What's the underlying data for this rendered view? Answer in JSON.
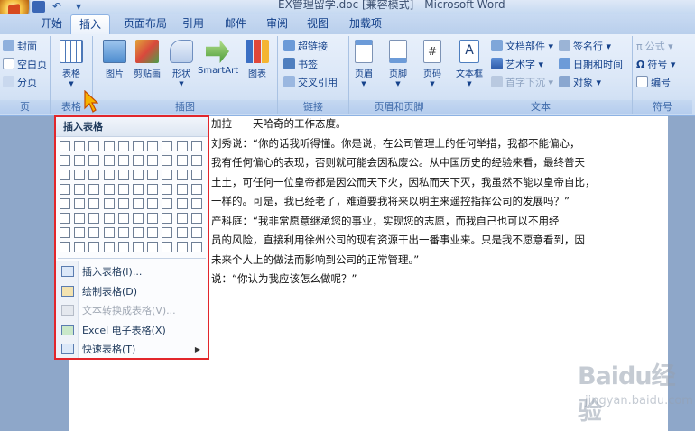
{
  "window": {
    "title": "EX管理留学.doc [兼容模式] - Microsoft Word"
  },
  "tabs": [
    {
      "label": "开始",
      "active": false
    },
    {
      "label": "插入",
      "active": true
    },
    {
      "label": "页面布局",
      "active": false
    },
    {
      "label": "引用",
      "active": false
    },
    {
      "label": "邮件",
      "active": false
    },
    {
      "label": "审阅",
      "active": false
    },
    {
      "label": "视图",
      "active": false
    },
    {
      "label": "加载项",
      "active": false
    }
  ],
  "ribbon": {
    "pages": {
      "label": "页",
      "items": [
        "封面",
        "空白页",
        "分页"
      ]
    },
    "tables": {
      "label": "表格",
      "button": "表格"
    },
    "illustrations": {
      "label": "插图",
      "buttons": [
        "图片",
        "剪贴画",
        "形状",
        "SmartArt",
        "图表"
      ]
    },
    "links": {
      "label": "链接",
      "items": [
        "超链接",
        "书签",
        "交叉引用"
      ]
    },
    "header_footer": {
      "label": "页眉和页脚",
      "buttons": [
        "页眉",
        "页脚",
        "页码"
      ]
    },
    "text": {
      "label": "文本",
      "textbox": "文本框",
      "items": [
        "文档部件",
        "艺术字",
        "首字下沉",
        "签名行",
        "日期和时间",
        "对象"
      ]
    },
    "symbols": {
      "label": "符号",
      "items": [
        "公式",
        "符号",
        "编号"
      ]
    }
  },
  "document": {
    "lines": [
      "加拉——天哈奇的工作态度。",
      "刘秀说：“你的话我听得懂。你是说，在公司管理上的任何举措，我都不能偏心，",
      "我有任何偏心的表现，否则就可能会因私废公。从中国历史的经验来看，最终普天",
      "土土，可任何一位皇帝都是因公而天下火，因私而天下灭，我虽然不能以皇帝自比，",
      "一样的。可是，我已经老了，难道要我将来以明主来遥控指挥公司的发展吗？”",
      "产科庭：“我非常愿意继承您的事业，实现您的志愿，而我自己也可以不用经",
      "员的风险，直接利用徐州公司的现有资源干出一番事业来。只是我不愿意看到，因",
      "未来个人上的做法而影响到公司的正常管理。”",
      "说：“你认为我应该怎么做呢？”"
    ]
  },
  "dropdown": {
    "title": "插入表格",
    "grid_rows": 8,
    "grid_cols": 10,
    "items": [
      {
        "label": "插入表格(I)...",
        "icon": "insert-table-icon",
        "enabled": true
      },
      {
        "label": "绘制表格(D)",
        "icon": "draw-table-icon",
        "enabled": true
      },
      {
        "label": "文本转换成表格(V)...",
        "icon": "convert-text-icon",
        "enabled": false
      },
      {
        "label": "Excel 电子表格(X)",
        "icon": "excel-icon",
        "enabled": true
      },
      {
        "label": "快速表格(T)",
        "icon": "quick-table-icon",
        "enabled": true
      }
    ]
  },
  "watermark": {
    "brand": "Baidu经验",
    "url": "jingyan.baidu.com"
  },
  "colors": {
    "accent": "#15428b",
    "highlight": "#e2262b"
  }
}
